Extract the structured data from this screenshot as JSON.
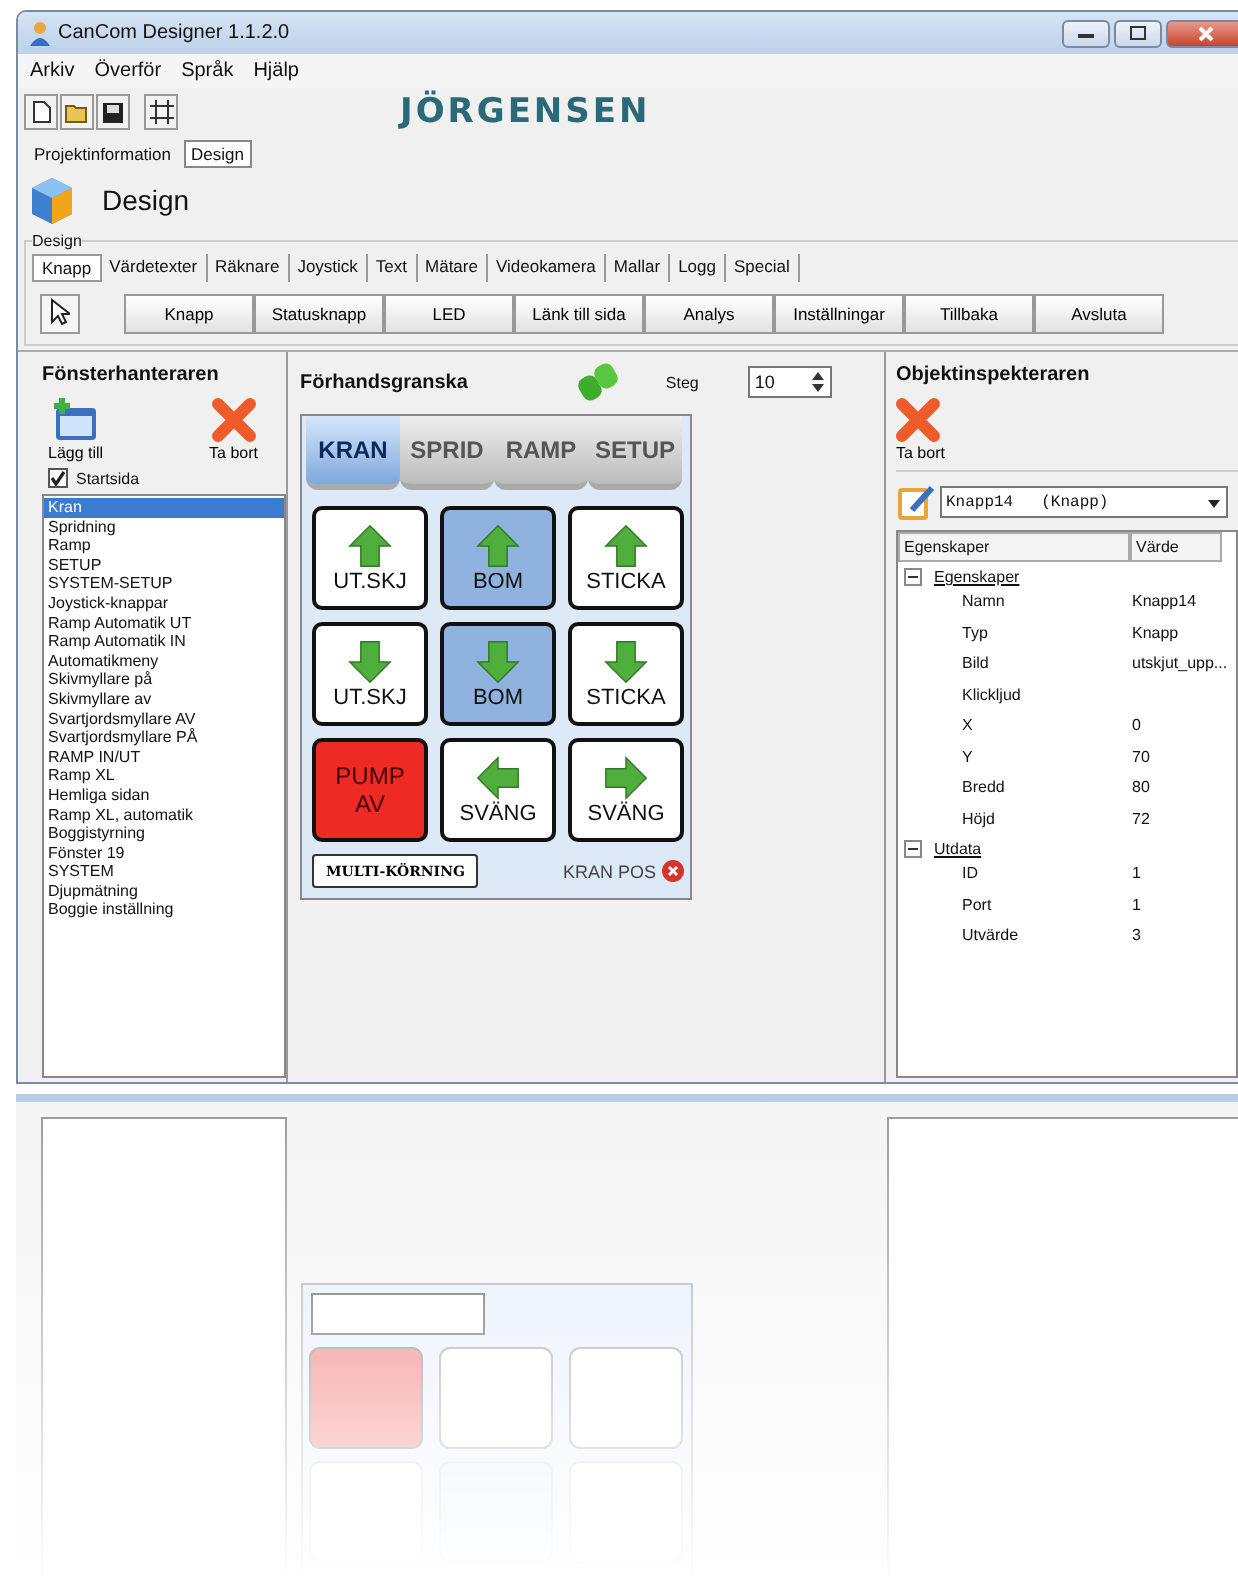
{
  "window": {
    "title": "CanCom Designer 1.1.2.0"
  },
  "menu": [
    "Arkiv",
    "Överför",
    "Språk",
    "Hjälp"
  ],
  "logo": "JÖRGENSEN",
  "main_tabs": [
    {
      "label": "Projektinformation",
      "selected": false
    },
    {
      "label": "Design",
      "selected": true
    }
  ],
  "page_title": "Design",
  "group_label": "Design",
  "design_tabs": [
    {
      "label": "Knapp",
      "selected": true
    },
    {
      "label": "Värdetexter",
      "selected": false
    },
    {
      "label": "Räknare",
      "selected": false
    },
    {
      "label": "Joystick",
      "selected": false
    },
    {
      "label": "Text",
      "selected": false
    },
    {
      "label": "Mätare",
      "selected": false
    },
    {
      "label": "Videokamera",
      "selected": false
    },
    {
      "label": "Mallar",
      "selected": false
    },
    {
      "label": "Logg",
      "selected": false
    },
    {
      "label": "Special",
      "selected": false
    }
  ],
  "tool_buttons": [
    "Knapp",
    "Statusknapp",
    "LED",
    "Länk till sida",
    "Analys",
    "Inställningar",
    "Tillbaka",
    "Avsluta"
  ],
  "window_manager": {
    "title": "Fönsterhanteraren",
    "add_label": "Lägg till",
    "delete_label": "Ta bort",
    "start_page": {
      "label": "Startsida",
      "checked": true
    },
    "pages": [
      {
        "label": "Kran",
        "selected": true
      },
      {
        "label": "Spridning",
        "selected": false
      },
      {
        "label": "Ramp",
        "selected": false
      },
      {
        "label": "SETUP",
        "selected": false
      },
      {
        "label": "SYSTEM-SETUP",
        "selected": false
      },
      {
        "label": "Joystick-knappar",
        "selected": false
      },
      {
        "label": "Ramp Automatik UT",
        "selected": false
      },
      {
        "label": "Ramp Automatik IN",
        "selected": false
      },
      {
        "label": "Automatikmeny",
        "selected": false
      },
      {
        "label": "Skivmyllare på",
        "selected": false
      },
      {
        "label": "Skivmyllare av",
        "selected": false
      },
      {
        "label": "Svartjordsmyllare AV",
        "selected": false
      },
      {
        "label": "Svartjordsmyllare PÅ",
        "selected": false
      },
      {
        "label": "RAMP IN/UT",
        "selected": false
      },
      {
        "label": "Ramp XL",
        "selected": false
      },
      {
        "label": "Hemliga sidan",
        "selected": false
      },
      {
        "label": "Ramp XL, automatik",
        "selected": false
      },
      {
        "label": "Boggistyrning",
        "selected": false
      },
      {
        "label": "Fönster 19",
        "selected": false
      },
      {
        "label": "SYSTEM",
        "selected": false
      },
      {
        "label": "Djupmätning",
        "selected": false
      },
      {
        "label": "Boggie inställning",
        "selected": false
      }
    ]
  },
  "preview": {
    "title": "Förhandsgranska",
    "step_label": "Steg",
    "step_value": "10",
    "tabs": [
      {
        "label": "KRAN",
        "selected": true
      },
      {
        "label": "SPRID",
        "selected": false
      },
      {
        "label": "RAMP",
        "selected": false
      },
      {
        "label": "SETUP",
        "selected": false
      }
    ],
    "buttons": [
      {
        "label": "UT.SKJ",
        "kind": "up",
        "color": "#ffffff"
      },
      {
        "label": "BOM",
        "kind": "up",
        "color": "#8fb3de"
      },
      {
        "label": "STICKA",
        "kind": "up",
        "color": "#ffffff"
      },
      {
        "label": "UT.SKJ",
        "kind": "down",
        "color": "#ffffff"
      },
      {
        "label": "BOM",
        "kind": "down",
        "color": "#8fb3de"
      },
      {
        "label": "STICKA",
        "kind": "down",
        "color": "#ffffff"
      },
      {
        "label": "PUMP AV",
        "kind": "plain",
        "color": "#ee2a24"
      },
      {
        "label": "SVÄNG",
        "kind": "left",
        "color": "#ffffff"
      },
      {
        "label": "SVÄNG",
        "kind": "right",
        "color": "#ffffff"
      }
    ],
    "multi_button": "MULTI-KÖRNING",
    "status_text": "KRAN POS"
  },
  "inspector": {
    "title": "Objektinspekteraren",
    "delete_label": "Ta bort",
    "object_name": "Knapp14",
    "object_type": "(Knapp)",
    "columns": [
      "Egenskaper",
      "Värde"
    ],
    "groups": [
      {
        "label": "Egenskaper",
        "expanded": true,
        "children": [
          {
            "name": "Namn",
            "value": "Knapp14"
          },
          {
            "name": "Typ",
            "value": "Knapp"
          },
          {
            "name": "Bild",
            "value": "utskjut_upp..."
          },
          {
            "name": "Klickljud"
          },
          {
            "name": "X",
            "value": "0"
          },
          {
            "name": "Y",
            "value": "70"
          },
          {
            "name": "Bredd",
            "value": "80"
          },
          {
            "name": "Höjd",
            "value": "72"
          }
        ]
      },
      {
        "label": "Utdata",
        "expanded": true,
        "children": [
          {
            "name": "ID",
            "value": "1"
          },
          {
            "name": "Port",
            "value": "1"
          },
          {
            "name": "Utvärde",
            "value": "3"
          }
        ]
      }
    ]
  }
}
